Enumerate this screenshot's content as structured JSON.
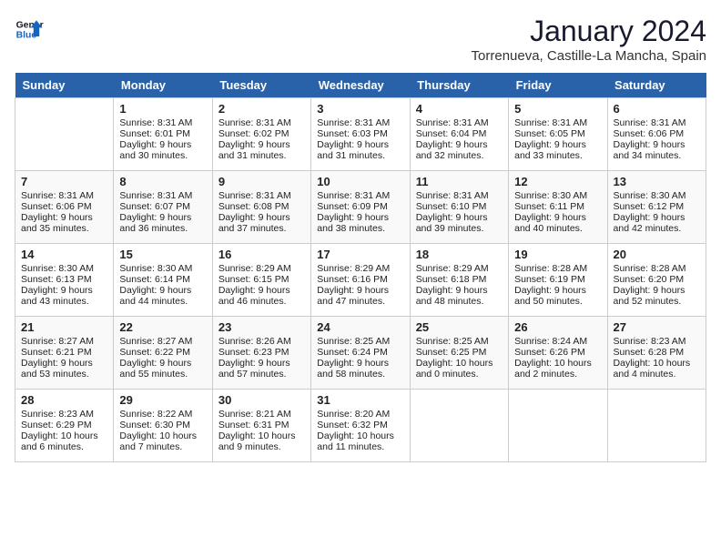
{
  "header": {
    "logo_line1": "General",
    "logo_line2": "Blue",
    "month": "January 2024",
    "location": "Torrenueva, Castille-La Mancha, Spain"
  },
  "weekdays": [
    "Sunday",
    "Monday",
    "Tuesday",
    "Wednesday",
    "Thursday",
    "Friday",
    "Saturday"
  ],
  "weeks": [
    [
      {
        "day": "",
        "info": ""
      },
      {
        "day": "1",
        "info": "Sunrise: 8:31 AM\nSunset: 6:01 PM\nDaylight: 9 hours\nand 30 minutes."
      },
      {
        "day": "2",
        "info": "Sunrise: 8:31 AM\nSunset: 6:02 PM\nDaylight: 9 hours\nand 31 minutes."
      },
      {
        "day": "3",
        "info": "Sunrise: 8:31 AM\nSunset: 6:03 PM\nDaylight: 9 hours\nand 31 minutes."
      },
      {
        "day": "4",
        "info": "Sunrise: 8:31 AM\nSunset: 6:04 PM\nDaylight: 9 hours\nand 32 minutes."
      },
      {
        "day": "5",
        "info": "Sunrise: 8:31 AM\nSunset: 6:05 PM\nDaylight: 9 hours\nand 33 minutes."
      },
      {
        "day": "6",
        "info": "Sunrise: 8:31 AM\nSunset: 6:06 PM\nDaylight: 9 hours\nand 34 minutes."
      }
    ],
    [
      {
        "day": "7",
        "info": "Sunrise: 8:31 AM\nSunset: 6:06 PM\nDaylight: 9 hours\nand 35 minutes."
      },
      {
        "day": "8",
        "info": "Sunrise: 8:31 AM\nSunset: 6:07 PM\nDaylight: 9 hours\nand 36 minutes."
      },
      {
        "day": "9",
        "info": "Sunrise: 8:31 AM\nSunset: 6:08 PM\nDaylight: 9 hours\nand 37 minutes."
      },
      {
        "day": "10",
        "info": "Sunrise: 8:31 AM\nSunset: 6:09 PM\nDaylight: 9 hours\nand 38 minutes."
      },
      {
        "day": "11",
        "info": "Sunrise: 8:31 AM\nSunset: 6:10 PM\nDaylight: 9 hours\nand 39 minutes."
      },
      {
        "day": "12",
        "info": "Sunrise: 8:30 AM\nSunset: 6:11 PM\nDaylight: 9 hours\nand 40 minutes."
      },
      {
        "day": "13",
        "info": "Sunrise: 8:30 AM\nSunset: 6:12 PM\nDaylight: 9 hours\nand 42 minutes."
      }
    ],
    [
      {
        "day": "14",
        "info": "Sunrise: 8:30 AM\nSunset: 6:13 PM\nDaylight: 9 hours\nand 43 minutes."
      },
      {
        "day": "15",
        "info": "Sunrise: 8:30 AM\nSunset: 6:14 PM\nDaylight: 9 hours\nand 44 minutes."
      },
      {
        "day": "16",
        "info": "Sunrise: 8:29 AM\nSunset: 6:15 PM\nDaylight: 9 hours\nand 46 minutes."
      },
      {
        "day": "17",
        "info": "Sunrise: 8:29 AM\nSunset: 6:16 PM\nDaylight: 9 hours\nand 47 minutes."
      },
      {
        "day": "18",
        "info": "Sunrise: 8:29 AM\nSunset: 6:18 PM\nDaylight: 9 hours\nand 48 minutes."
      },
      {
        "day": "19",
        "info": "Sunrise: 8:28 AM\nSunset: 6:19 PM\nDaylight: 9 hours\nand 50 minutes."
      },
      {
        "day": "20",
        "info": "Sunrise: 8:28 AM\nSunset: 6:20 PM\nDaylight: 9 hours\nand 52 minutes."
      }
    ],
    [
      {
        "day": "21",
        "info": "Sunrise: 8:27 AM\nSunset: 6:21 PM\nDaylight: 9 hours\nand 53 minutes."
      },
      {
        "day": "22",
        "info": "Sunrise: 8:27 AM\nSunset: 6:22 PM\nDaylight: 9 hours\nand 55 minutes."
      },
      {
        "day": "23",
        "info": "Sunrise: 8:26 AM\nSunset: 6:23 PM\nDaylight: 9 hours\nand 57 minutes."
      },
      {
        "day": "24",
        "info": "Sunrise: 8:25 AM\nSunset: 6:24 PM\nDaylight: 9 hours\nand 58 minutes."
      },
      {
        "day": "25",
        "info": "Sunrise: 8:25 AM\nSunset: 6:25 PM\nDaylight: 10 hours\nand 0 minutes."
      },
      {
        "day": "26",
        "info": "Sunrise: 8:24 AM\nSunset: 6:26 PM\nDaylight: 10 hours\nand 2 minutes."
      },
      {
        "day": "27",
        "info": "Sunrise: 8:23 AM\nSunset: 6:28 PM\nDaylight: 10 hours\nand 4 minutes."
      }
    ],
    [
      {
        "day": "28",
        "info": "Sunrise: 8:23 AM\nSunset: 6:29 PM\nDaylight: 10 hours\nand 6 minutes."
      },
      {
        "day": "29",
        "info": "Sunrise: 8:22 AM\nSunset: 6:30 PM\nDaylight: 10 hours\nand 7 minutes."
      },
      {
        "day": "30",
        "info": "Sunrise: 8:21 AM\nSunset: 6:31 PM\nDaylight: 10 hours\nand 9 minutes."
      },
      {
        "day": "31",
        "info": "Sunrise: 8:20 AM\nSunset: 6:32 PM\nDaylight: 10 hours\nand 11 minutes."
      },
      {
        "day": "",
        "info": ""
      },
      {
        "day": "",
        "info": ""
      },
      {
        "day": "",
        "info": ""
      }
    ]
  ]
}
